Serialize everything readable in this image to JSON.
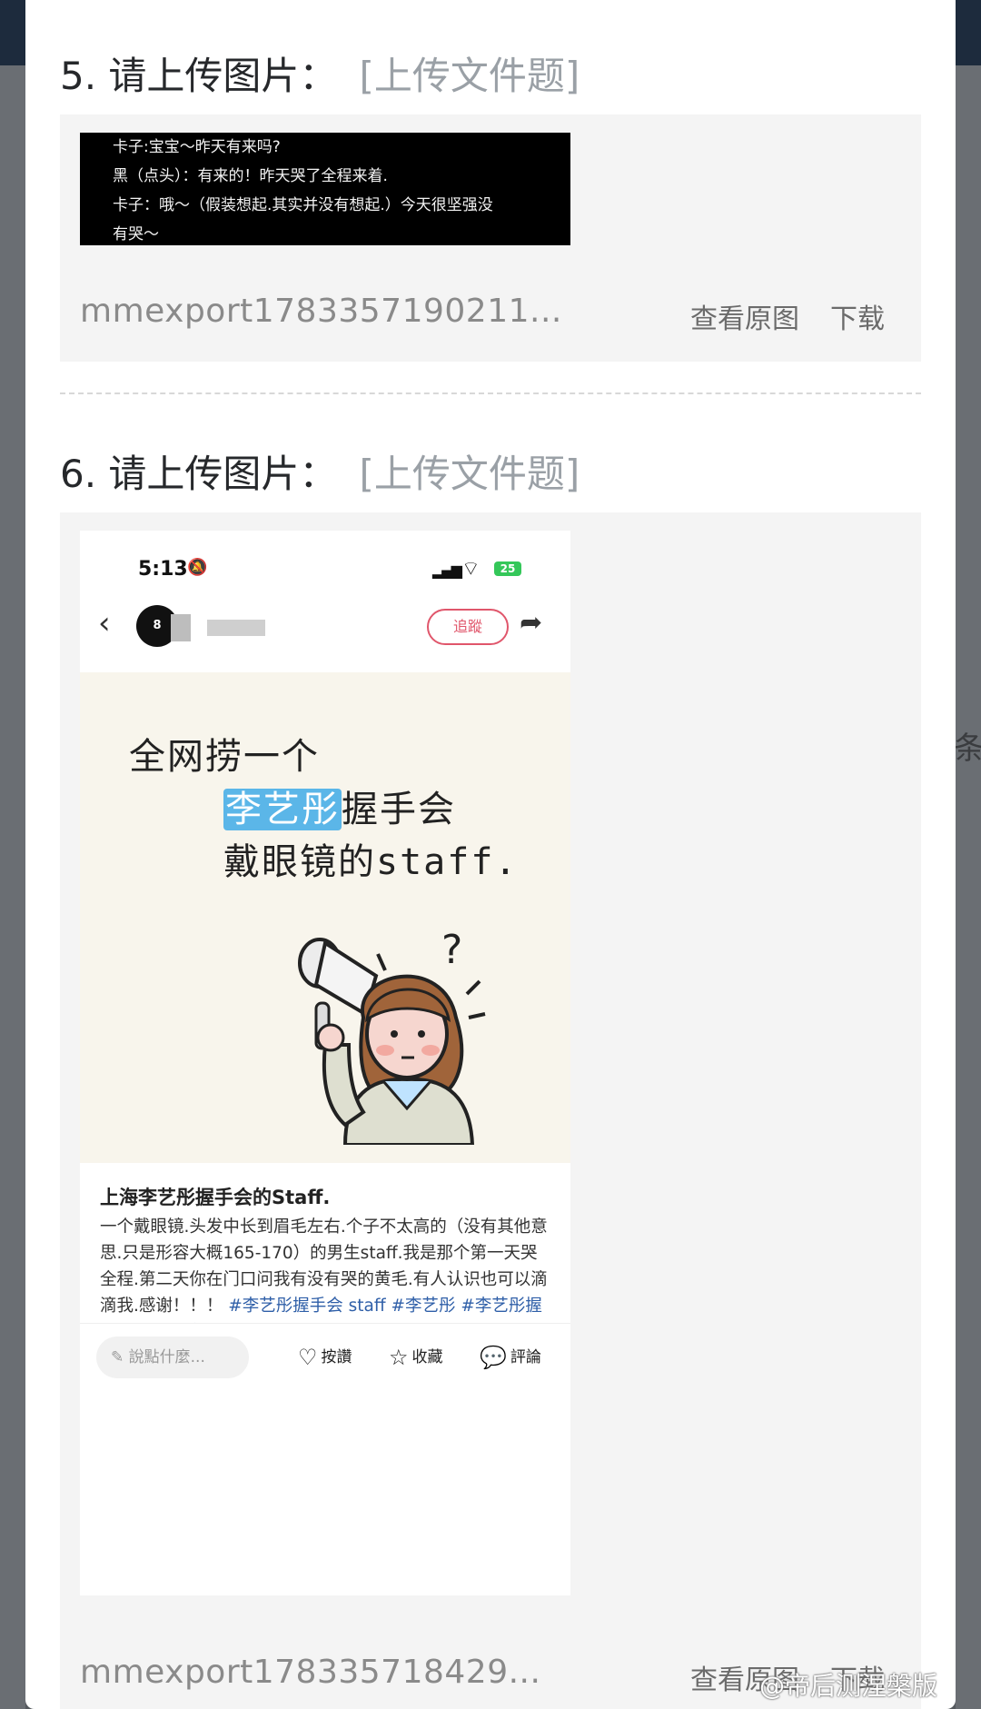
{
  "background": {
    "partial_label_right": "条"
  },
  "q5": {
    "title": "5. 请上传图片：",
    "tag": "[上传文件题]",
    "image_lines": [
      "卡子:宝宝～昨天有来吗?",
      "黑（点头）：有来的！昨天哭了全程来着.",
      "卡子：哦～（假装想起.其实并没有想起.）今天很坚强没",
      "有哭～"
    ],
    "filename": "mmexport1783357190211...",
    "view_label": "查看原图",
    "download_label": "下载"
  },
  "q6": {
    "title": "6. 请上传图片：",
    "tag": "[上传文件题]",
    "filename": "mmexport178335718429...",
    "view_label": "查看原图",
    "download_label": "下载",
    "phone": {
      "time": "5:13",
      "battery": "25",
      "avatar_text": "8",
      "follow_label": "追蹤",
      "poster_line1": "全网捞一个",
      "poster_highlight": "李艺彤",
      "poster_line2_rest": "握手会",
      "poster_line3": "戴眼镜的staff.",
      "post_title": "上海李艺彤握手会的Staff.",
      "post_body": "一个戴眼镜.头发中长到眉毛左右.个子不太高的（没有其他意思.只是形容大概165-170）的男生staff.我是那个第一天哭全程.第二天你在门口问我有没有哭的黄毛.有人认识也可以滴滴我.感谢！！！",
      "post_tags": "#李艺彤握手会 staff #李艺彤 #李艺彤握手会 #星在文化中心未来剧",
      "comment_placeholder": "說點什麼...",
      "like_label": "按讚",
      "fav_label": "收藏",
      "comment_label": "評論"
    }
  },
  "watermark": "@帝后测涅槃版"
}
